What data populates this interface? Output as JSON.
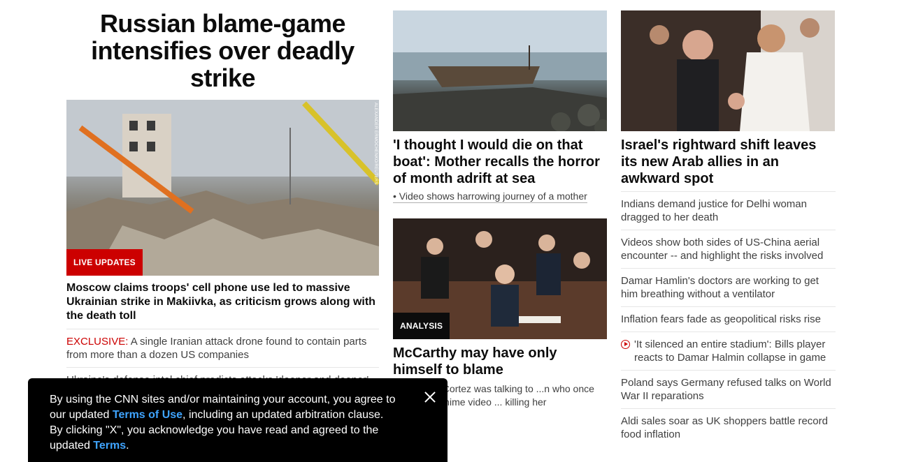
{
  "lead": {
    "headline": "Russian blame-game intensifies over deadly strike",
    "image_credit": "ALEXANDER ERMOCHENKO/REUTERS",
    "badge": "LIVE UPDATES",
    "subheadline": "Moscow claims troops' cell phone use led to massive Ukrainian strike in Makiivka, as criticism grows along with the death toll",
    "items": [
      {
        "tag": "EXCLUSIVE:",
        "text": " A single Iranian attack drone found to contain parts from more than a dozen US companies"
      },
      {
        "tag": "",
        "text": "Ukraine's defense intel chief predicts attacks 'deeper and deeper'"
      }
    ]
  },
  "middle": {
    "card1": {
      "headline": "'I thought I would die on that boat': Mother recalls the horror of month adrift at sea",
      "link": "• Video shows harrowing journey of a mother"
    },
    "card2": {
      "badge": "ANALYSIS",
      "headline": "McCarthy may have only himself to blame",
      "body": "...y Ocasio-Cortez was talking to ...n who once posted an anime video ... killing her"
    }
  },
  "right": {
    "headline": "Israel's rightward shift leaves its new Arab allies in an awkward spot",
    "items": [
      {
        "text": "Indians demand justice for Delhi woman dragged to her death",
        "icon": ""
      },
      {
        "text": "Videos show both sides of US-China aerial encounter -- and highlight the risks involved",
        "icon": ""
      },
      {
        "text": "Damar Hamlin's doctors are working to get him breathing without a ventilator",
        "icon": ""
      },
      {
        "text": "Inflation fears fade as geopolitical risks rise",
        "icon": ""
      },
      {
        "text": "'It silenced an entire stadium': Bills player reacts to Damar Halmin collapse in game",
        "icon": "play-icon"
      },
      {
        "text": "Poland says Germany refused talks on World War II reparations",
        "icon": ""
      },
      {
        "text": "Aldi sales soar as UK shoppers battle record food inflation",
        "icon": ""
      }
    ]
  },
  "consent": {
    "text1": "By using the CNN sites and/or maintaining your account, you agree to our updated ",
    "terms_link": "Terms of Use",
    "text2": ", including an updated arbitration clause. By clicking \"X\", you acknowledge you have read and agreed to the updated ",
    "terms_short": "Terms",
    "text3": "."
  }
}
